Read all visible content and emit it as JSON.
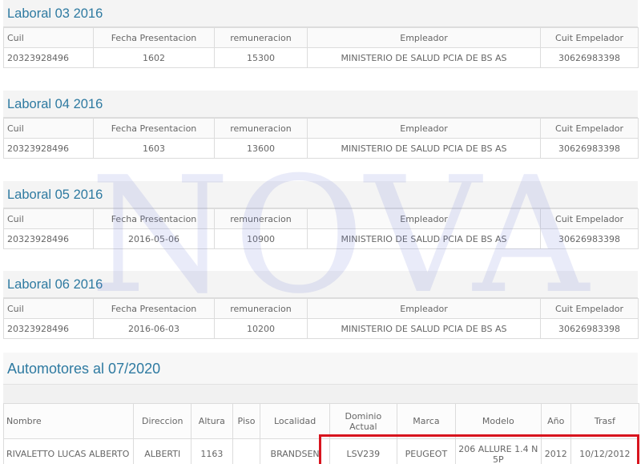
{
  "laboral_headers": [
    "Cuil",
    "Fecha Presentacion",
    "remuneracion",
    "Empleador",
    "Cuit Empelador"
  ],
  "laboral": [
    {
      "title": "Laboral 03 2016",
      "row": [
        "20323928496",
        "1602",
        "15300",
        "MINISTERIO DE SALUD PCIA DE BS AS",
        "30626983398"
      ]
    },
    {
      "title": "Laboral 04 2016",
      "row": [
        "20323928496",
        "1603",
        "13600",
        "MINISTERIO DE SALUD PCIA DE BS AS",
        "30626983398"
      ]
    },
    {
      "title": "Laboral 05 2016",
      "row": [
        "20323928496",
        "2016-05-06",
        "10900",
        "MINISTERIO DE SALUD PCIA DE BS AS",
        "30626983398"
      ]
    },
    {
      "title": "Laboral 06 2016",
      "row": [
        "20323928496",
        "2016-06-03",
        "10200",
        "MINISTERIO DE SALUD PCIA DE BS AS",
        "30626983398"
      ]
    }
  ],
  "automotores": {
    "title": "Automotores al 07/2020",
    "headers": [
      "Nombre",
      "Direccion",
      "Altura",
      "Piso",
      "Localidad",
      "Dominio Actual",
      "Marca",
      "Modelo",
      "Año",
      "Trasf"
    ],
    "row": [
      "RIVALETTO LUCAS ALBERTO",
      "ALBERTI",
      "1163",
      "",
      "BRANDSEN",
      "LSV239",
      "PEUGEOT",
      "206 ALLURE 1.4 N 5P",
      "2012",
      "10/12/2012"
    ]
  },
  "watermark": "NOVA",
  "colors": {
    "title": "#2e7aa1",
    "highlight": "#d8141e",
    "watermark": "#7882dc"
  }
}
